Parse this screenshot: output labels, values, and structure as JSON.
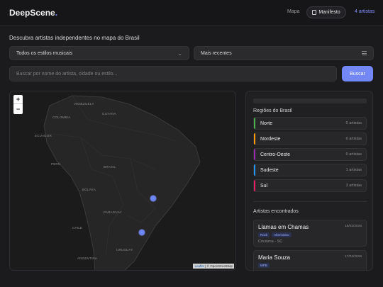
{
  "header": {
    "logo_text": "DeepScene",
    "logo_dot": ".",
    "nav": {
      "mapa": "Mapa",
      "manifesto": "Manifesto",
      "count": "4 artistas"
    }
  },
  "heading": "Descubra artistas independentes no mapa do Brasil",
  "filters": {
    "genre_selected": "Todos os estilos musicais",
    "sort_selected": "Mais recentes",
    "search_placeholder": "Buscar por nome do artista, cidade ou estilo...",
    "search_button": "Buscar"
  },
  "map": {
    "zoom_in": "+",
    "zoom_out": "−",
    "attribution_leaflet": "Leaflet",
    "attribution_rest": " | © OpenStreetMap",
    "labels": [
      "VENEZUELA",
      "GUYANA",
      "COLOMBIA",
      "ECUADOR",
      "PERU",
      "BRASIL",
      "BOLIVIA",
      "PARAGUAY",
      "CHILE",
      "ARGENTINA",
      "URUGUAY"
    ],
    "marker_count": 2
  },
  "panel": {
    "regions_title": "Regiões do Brasil",
    "regions": [
      {
        "name": "Norte",
        "count": "0 artistas",
        "color": "#4caf50"
      },
      {
        "name": "Nordeste",
        "count": "0 artistas",
        "color": "#ff9800"
      },
      {
        "name": "Centro-Oeste",
        "count": "0 artistas",
        "color": "#9c27b0"
      },
      {
        "name": "Sudeste",
        "count": "1 artistas",
        "color": "#2196f3"
      },
      {
        "name": "Sul",
        "count": "3 artistas",
        "color": "#e91e63"
      }
    ],
    "artists_title": "Artistas encontrados",
    "artists": [
      {
        "name": "Llamas em Chamas",
        "date": "18/02/2026",
        "tags": [
          "Rock",
          "Alternativo"
        ],
        "location": "Criciúma - SC"
      },
      {
        "name": "Maria Souza",
        "date": "17/02/2026",
        "tags": [
          "MPB"
        ],
        "location": ""
      }
    ]
  },
  "colors": {
    "accent": "#7387f5",
    "background": "#1b1b1d",
    "card": "#27272a"
  }
}
